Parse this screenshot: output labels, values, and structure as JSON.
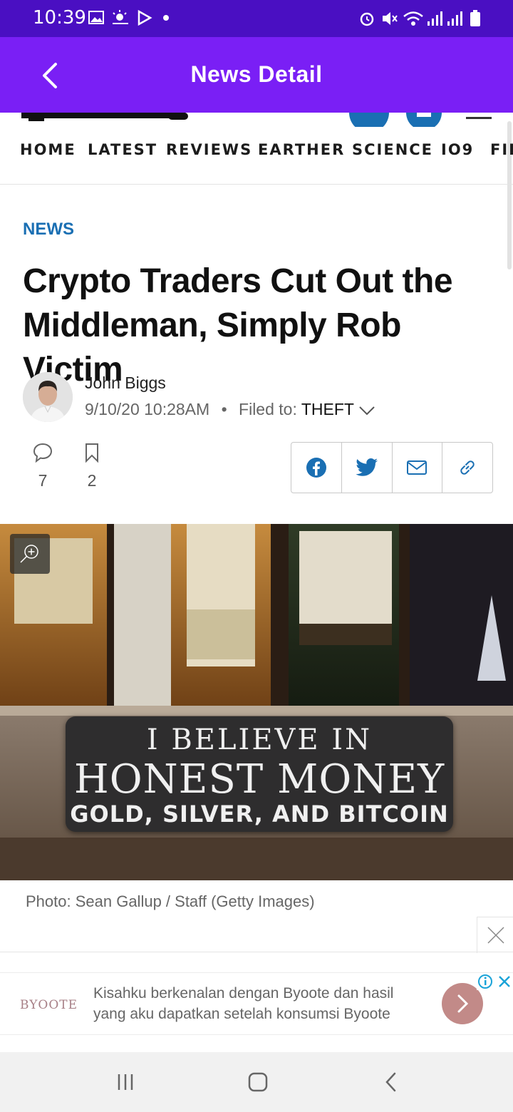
{
  "status_bar": {
    "time": "10:39",
    "icons_left": [
      "image-icon",
      "weather-icon",
      "play-store-icon",
      "dot-icon"
    ],
    "icons_right": [
      "alarm-icon",
      "mute-icon",
      "wifi-icon",
      "signal-icon",
      "signal-icon",
      "battery-icon"
    ]
  },
  "app_bar": {
    "title": "News Detail",
    "back_icon": "chevron-left-icon",
    "color": "#7a1ff5"
  },
  "site": {
    "nav": [
      "HOME",
      "LATEST",
      "REVIEWS",
      "EARTHER",
      "SCIENCE",
      "IO9",
      "FIE"
    ]
  },
  "article": {
    "category": "NEWS",
    "headline": "Crypto Traders Cut Out the Middleman, Simply Rob Victim",
    "author": "John Biggs",
    "date": "9/10/20 10:28AM",
    "separator": "•",
    "filed_label": "Filed to:",
    "filed_tag": "THEFT",
    "comments_count": "7",
    "bookmarks_count": "2",
    "share_icons": [
      "facebook-icon",
      "twitter-icon",
      "mail-icon",
      "link-icon"
    ],
    "photo": {
      "sign_line1": "I BELIEVE IN",
      "sign_line2": "HONEST MONEY",
      "sign_line3": "GOLD, SILVER, AND BITCOIN"
    },
    "caption": "Photo: Sean Gallup / Staff (Getty Images)"
  },
  "ad": {
    "brand": "BYOOTE",
    "text": "Kisahku berkenalan dengan Byoote dan hasil yang aku dapatkan setelah konsumsi Byoote"
  },
  "colors": {
    "status_bar": "#4a0fc2",
    "accent_blue": "#1a6fb3",
    "ad_button": "#c28a88"
  }
}
